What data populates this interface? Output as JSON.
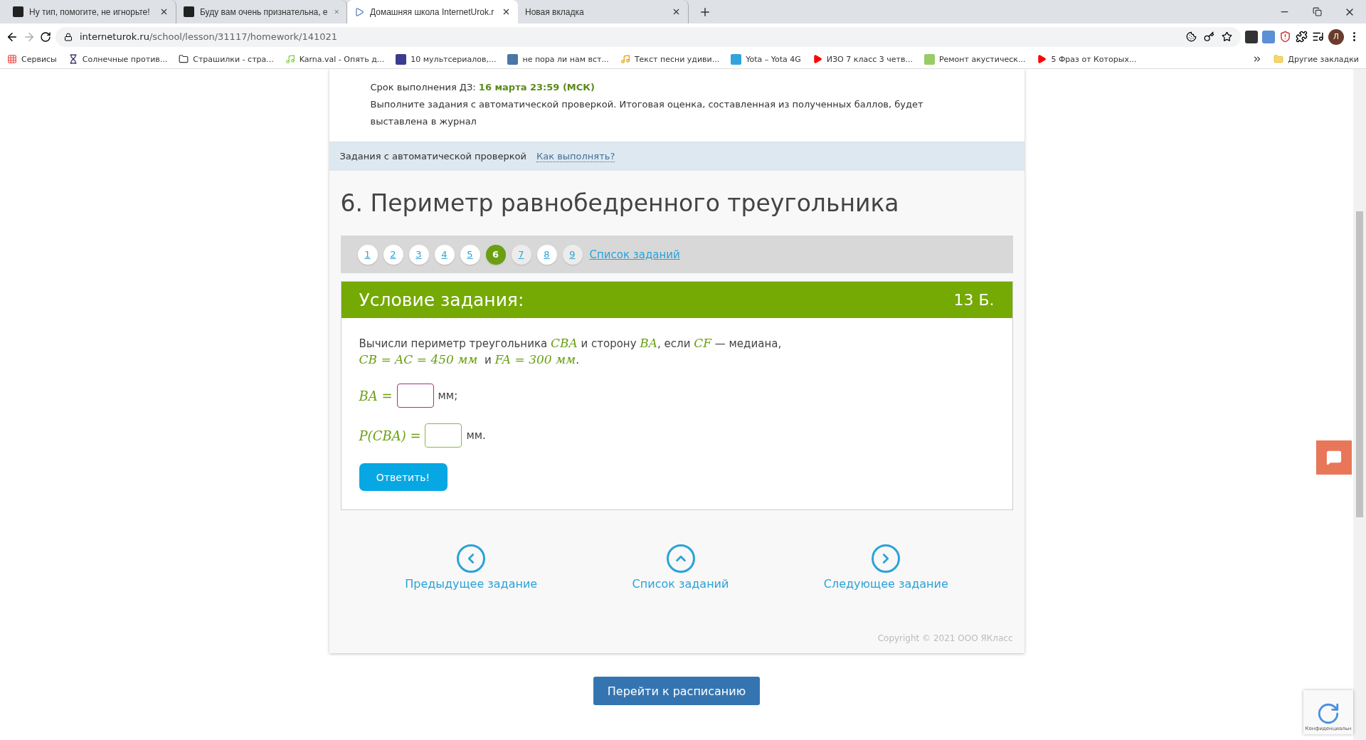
{
  "browser": {
    "tabs": [
      {
        "title": "Ну тип, помогите, не игнорьте!",
        "selected": false,
        "kind": "z"
      },
      {
        "title": "Буду вам очень признательна, е",
        "selected": false,
        "kind": "z"
      },
      {
        "title": "Домашняя школа InternetUrok.r",
        "selected": true,
        "kind": "play"
      },
      {
        "title": "Новая вкладка",
        "selected": false,
        "kind": "none"
      }
    ],
    "url_host": "interneturok.ru",
    "url_path": "/school/lesson/31117/homework/141021",
    "profile": "Л",
    "bookmarks": [
      {
        "title": "Сервисы",
        "kind": "apps"
      },
      {
        "title": "Солнечные против...",
        "kind": "hourglass"
      },
      {
        "title": "Страшилки - стра...",
        "kind": "h"
      },
      {
        "title": "Karna.val - Опять д...",
        "kind": "music"
      },
      {
        "title": "10 мультсериалов,...",
        "kind": "w"
      },
      {
        "title": "не пора ли нам вст...",
        "kind": "vk"
      },
      {
        "title": "Текст песни удиви...",
        "kind": "note"
      },
      {
        "title": "Yota – Yota 4G",
        "kind": "yota"
      },
      {
        "title": "ИЗО 7 класс 3 четв...",
        "kind": "yt"
      },
      {
        "title": "Ремонт акустическ...",
        "kind": "dots"
      },
      {
        "title": "5 Фраз от Которых...",
        "kind": "yt"
      }
    ],
    "other_bookmarks": "Другие закладки"
  },
  "intro": {
    "deadline_label": "Срок выполнения ДЗ: ",
    "deadline": "16 марта 23:59 (МСК)",
    "note": "Выполните задания с автоматической проверкой. Итоговая оценка, составленная из полученных баллов, будет выставлена в журнал"
  },
  "section": {
    "label": "Задания с автоматической проверкой",
    "link": "Как выполнять?"
  },
  "title": "6. Периметр равнобедренного треугольника",
  "pagination": {
    "pages": [
      {
        "label": "1",
        "selected": false,
        "done": true
      },
      {
        "label": "2",
        "selected": false,
        "done": true
      },
      {
        "label": "3",
        "selected": false,
        "done": true
      },
      {
        "label": "4",
        "selected": false,
        "done": true
      },
      {
        "label": "5",
        "selected": false,
        "done": true
      },
      {
        "label": "6",
        "selected": true,
        "done": true
      },
      {
        "label": "7",
        "selected": false,
        "done": false
      },
      {
        "label": "8",
        "selected": false,
        "done": true
      },
      {
        "label": "9",
        "selected": false,
        "done": false
      }
    ],
    "list_link": "Список заданий"
  },
  "task": {
    "header": "Условие задания:",
    "points": "13 Б.",
    "statement": [
      [
        {
          "kind": "text",
          "text": "Вычисли периметр треугольника "
        },
        {
          "kind": "math",
          "text": "CBA"
        },
        {
          "kind": "text",
          "text": " и сторону "
        },
        {
          "kind": "math",
          "text": "BA"
        },
        {
          "kind": "text",
          "text": ", если "
        },
        {
          "kind": "math",
          "text": "CF"
        },
        {
          "kind": "text",
          "text": " — медиана,"
        }
      ],
      [
        {
          "kind": "math",
          "text": "CB = AC = 450 мм"
        },
        {
          "kind": "text",
          "text": "  и "
        },
        {
          "kind": "math",
          "text": "FA = 300 мм"
        },
        {
          "kind": "text",
          "text": "."
        }
      ]
    ],
    "answers": [
      {
        "label": "BA =",
        "unit": "мм;",
        "focused": true
      },
      {
        "label": "P(CBA) =",
        "unit": "мм.",
        "focused": false
      }
    ],
    "submit": "Ответить!"
  },
  "nav": [
    {
      "kind": "prev",
      "label": "Предыдущее задание"
    },
    {
      "kind": "list",
      "label": "Список заданий"
    },
    {
      "kind": "next",
      "label": "Следующее задание"
    }
  ],
  "copyright": "Copyright © 2021 ООО ЯКласс",
  "schedule_button": "Перейти к расписанию",
  "recaptcha": "Конфиденциальн"
}
